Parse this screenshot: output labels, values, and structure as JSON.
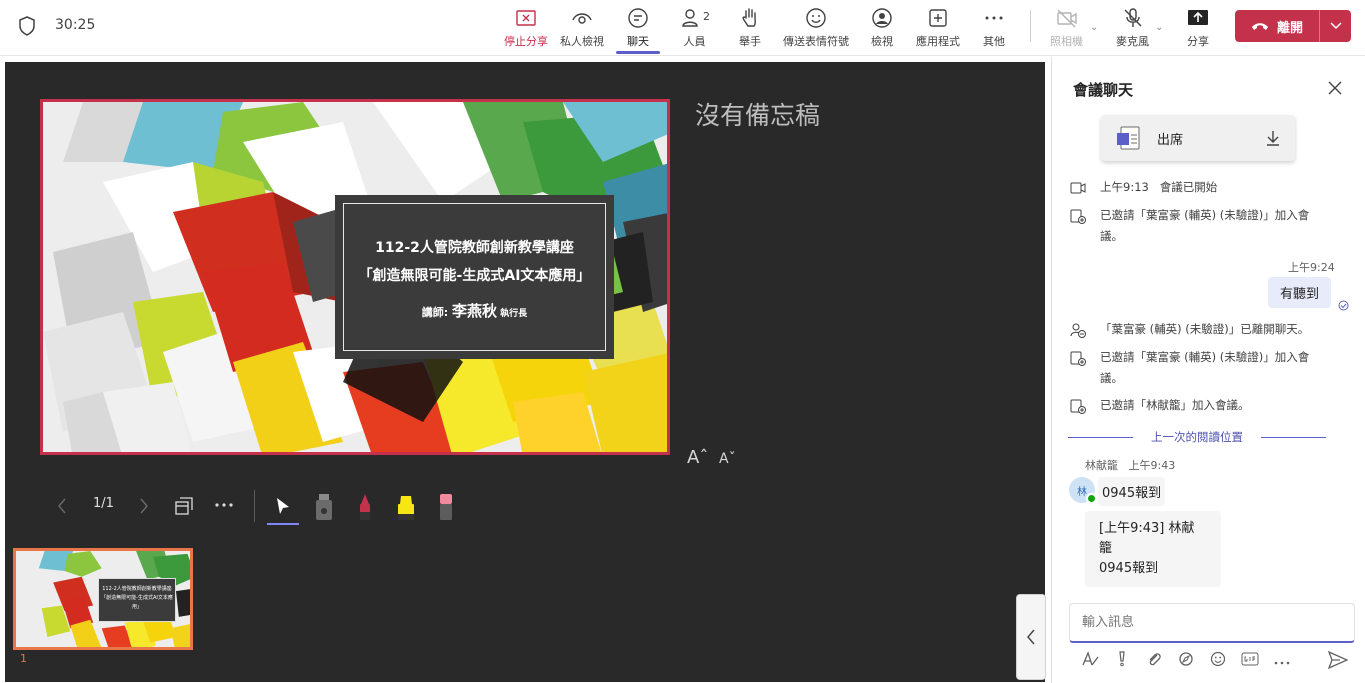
{
  "timer": "30:25",
  "toolbar": {
    "stop_share": "停止分享",
    "private_view": "私人檢視",
    "chat": "聊天",
    "people": "人員",
    "people_count": "2",
    "raise_hand": "舉手",
    "send_reaction": "傳送表情符號",
    "view": "檢視",
    "apps": "應用程式",
    "more": "其他",
    "camera": "照相機",
    "mic": "麥克風",
    "share": "分享",
    "leave": "離開"
  },
  "stage": {
    "notes_placeholder": "沒有備忘稿",
    "font_up": "Aˆ",
    "font_down": "Aˇ",
    "page_indicator": "1/1",
    "thumb_number": "1",
    "slide": {
      "line1": "112-2人管院教師創新教學講座",
      "line2": "「創造無限可能-生成式AI文本應用」",
      "lecturer_label": "講師: ",
      "lecturer_name": "李燕秋",
      "lecturer_title": " 執行長"
    }
  },
  "chat": {
    "title": "會議聊天",
    "file_name": "出席",
    "events": [
      {
        "time": "上午9:13",
        "text": "會議已開始"
      },
      {
        "text": "已邀請「葉富豪 (輔英) (未驗證)」加入會議。"
      },
      {
        "text": "「葉富豪 (輔英) (未驗證)」已離開聊天。"
      },
      {
        "text": "已邀請「葉富豪 (輔英) (未驗證)」加入會議。"
      },
      {
        "text": "已邀請「林献籠」加入會議。"
      }
    ],
    "my_time": "上午9:24",
    "my_message": "有聽到",
    "last_read": "上一次的閱讀位置",
    "sender_name": "林献籠",
    "sender_time": "上午9:43",
    "avatar_initial": "林",
    "message1": "0945報到",
    "message2_line1": "[上午9:43] 林献籠",
    "message2_line2": "0945報到",
    "input_placeholder": "輸入訊息"
  },
  "colors": {
    "accent": "#5b5fc7",
    "leave": "#c4314b",
    "stage_bg": "#292929",
    "slide_border": "#c4314b",
    "thumb_border": "#e97548"
  }
}
